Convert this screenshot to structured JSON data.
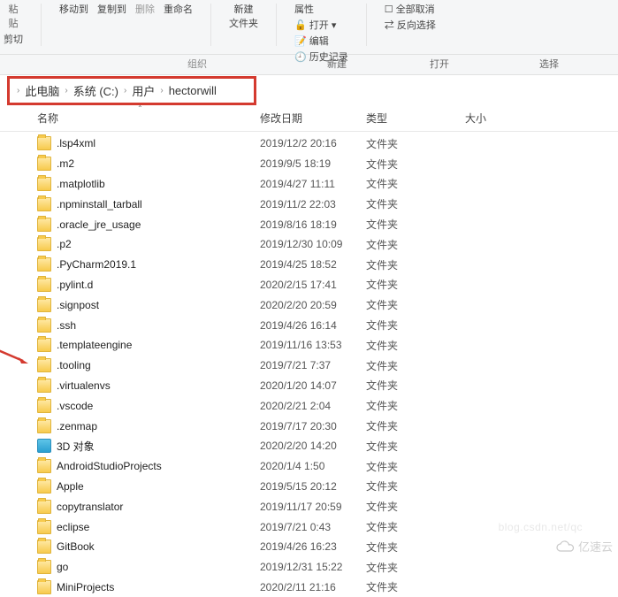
{
  "ribbon": {
    "paste_sub": "粘贴",
    "cut": "剪切",
    "move_to": "移动到",
    "copy_to": "复制到",
    "delete": "删除",
    "rename": "重命名",
    "new_folder": "新建\n文件夹",
    "properties": "属性",
    "history": "历史记录",
    "open_menu": "打开",
    "edit": "编辑",
    "select_none": "全部取消",
    "invert": "反向选择",
    "group_new": "新建",
    "group_open": "打开",
    "group_select": "选择",
    "group_org": "组织"
  },
  "breadcrumb": {
    "root": "此电脑",
    "drive": "系统 (C:)",
    "users": "用户",
    "user": "hectorwill"
  },
  "columns": {
    "name": "名称",
    "date": "修改日期",
    "type": "类型",
    "size": "大小"
  },
  "type_folder": "文件夹",
  "files": [
    {
      "name": ".lsp4xml",
      "date": "2019/12/2 20:16",
      "kind": "folder"
    },
    {
      "name": ".m2",
      "date": "2019/9/5 18:19",
      "kind": "folder"
    },
    {
      "name": ".matplotlib",
      "date": "2019/4/27 11:11",
      "kind": "folder"
    },
    {
      "name": ".npminstall_tarball",
      "date": "2019/11/2 22:03",
      "kind": "folder"
    },
    {
      "name": ".oracle_jre_usage",
      "date": "2019/8/16 18:19",
      "kind": "folder"
    },
    {
      "name": ".p2",
      "date": "2019/12/30 10:09",
      "kind": "folder"
    },
    {
      "name": ".PyCharm2019.1",
      "date": "2019/4/25 18:52",
      "kind": "folder"
    },
    {
      "name": ".pylint.d",
      "date": "2020/2/15 17:41",
      "kind": "folder"
    },
    {
      "name": ".signpost",
      "date": "2020/2/20 20:59",
      "kind": "folder"
    },
    {
      "name": ".ssh",
      "date": "2019/4/26 16:14",
      "kind": "folder"
    },
    {
      "name": ".templateengine",
      "date": "2019/11/16 13:53",
      "kind": "folder"
    },
    {
      "name": ".tooling",
      "date": "2019/7/21 7:37",
      "kind": "folder"
    },
    {
      "name": ".virtualenvs",
      "date": "2020/1/20 14:07",
      "kind": "folder"
    },
    {
      "name": ".vscode",
      "date": "2020/2/21 2:04",
      "kind": "folder"
    },
    {
      "name": ".zenmap",
      "date": "2019/7/17 20:30",
      "kind": "folder"
    },
    {
      "name": "3D 对象",
      "date": "2020/2/20 14:20",
      "kind": "3d"
    },
    {
      "name": "AndroidStudioProjects",
      "date": "2020/1/4 1:50",
      "kind": "folder"
    },
    {
      "name": "Apple",
      "date": "2019/5/15 20:12",
      "kind": "folder"
    },
    {
      "name": "copytranslator",
      "date": "2019/11/17 20:59",
      "kind": "folder"
    },
    {
      "name": "eclipse",
      "date": "2019/7/21 0:43",
      "kind": "folder"
    },
    {
      "name": "GitBook",
      "date": "2019/4/26 16:23",
      "kind": "folder"
    },
    {
      "name": "go",
      "date": "2019/12/31 15:22",
      "kind": "folder"
    },
    {
      "name": "MiniProjects",
      "date": "2020/2/11 21:16",
      "kind": "folder"
    }
  ],
  "watermark": "亿速云",
  "watermark_blog": "blog.csdn.net/qc"
}
